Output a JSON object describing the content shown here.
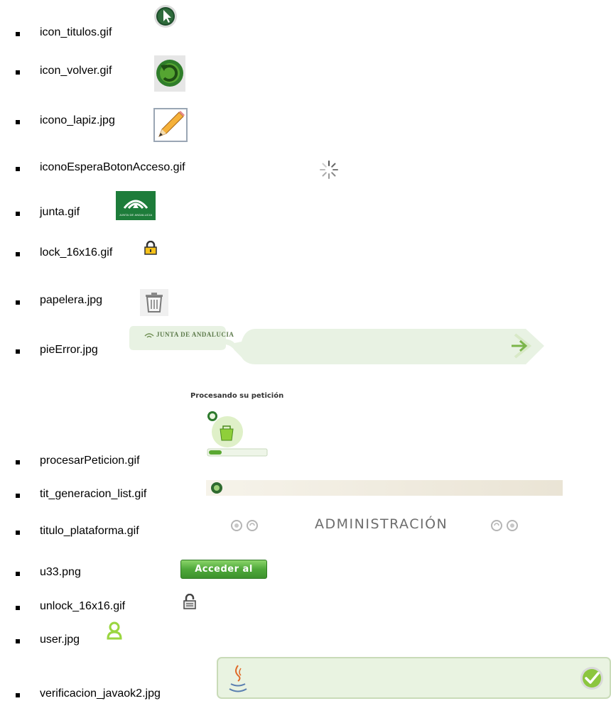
{
  "files": [
    {
      "name": "icon_titulos.gif",
      "icon": "cursor-circle-icon"
    },
    {
      "name": "icon_volver.gif",
      "icon": "back-arrow-icon"
    },
    {
      "name": "icono_lapiz.jpg",
      "icon": "pencil-icon"
    },
    {
      "name": "iconoEsperaBotonAcceso.gif",
      "icon": "spinner-icon"
    },
    {
      "name": "junta.gif",
      "icon": "junta-logo"
    },
    {
      "name": "lock_16x16.gif",
      "icon": "lock-icon"
    },
    {
      "name": "papelera.jpg",
      "icon": "trash-icon"
    },
    {
      "name": "pieError.jpg",
      "icon": "error-footer-banner"
    },
    {
      "name": "procesarPeticion.gif",
      "icon": "processing-animation"
    },
    {
      "name": "tit_generacion_list.gif",
      "icon": "title-bar"
    },
    {
      "name": "titulo_plataforma.gif",
      "icon": "platform-title"
    },
    {
      "name": "u33.png",
      "icon": "access-button"
    },
    {
      "name": "unlock_16x16.gif",
      "icon": "unlock-icon"
    },
    {
      "name": "user.jpg",
      "icon": "user-icon"
    },
    {
      "name": "verificacion_javaok2.jpg",
      "icon": "java-verification-bar"
    }
  ],
  "assets": {
    "junta_text": "JUNTA DE ANDALUCIA",
    "pie_error_text": "JUNTA DE ANDALUCIA",
    "procesar_title": "Procesando su petición",
    "plataforma_title": "ADMINISTRACIÓN",
    "acceder_label": "Acceder al sistema"
  },
  "colors": {
    "junta_green": "#1d7c3a",
    "button_green": "#4fa83a",
    "banner_bg": "#e8f2e3"
  }
}
